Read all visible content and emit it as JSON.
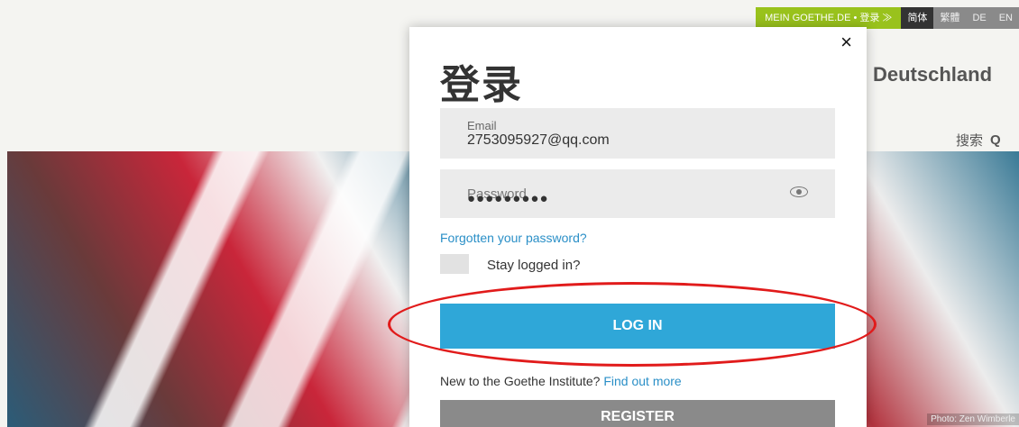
{
  "topbar": {
    "mein_goethe": "MEIN GOETHE.DE • 登录 ≫",
    "languages": [
      "简体",
      "繁體",
      "DE",
      "EN"
    ]
  },
  "header": {
    "site_name_partial": "Deutschland",
    "search_label": "搜索",
    "search_icon_glyph": "Q"
  },
  "modal": {
    "close_glyph": "×",
    "title": "登录",
    "email_label": "Email",
    "email_value": "2753095927@qq.com",
    "password_label": "Password",
    "password_dots": "●●●●●●●●●",
    "forgot_link": "Forgotten your password?",
    "stay_logged_in": "Stay logged in?",
    "login_button": "LOG IN",
    "new_text": "New to the Goethe Institute?",
    "find_out_more": "Find out more",
    "register_button": "REGISTER"
  },
  "hero": {
    "photo_credit": "Photo: Zen Wimberle"
  },
  "colors": {
    "accent_green": "#99c21c",
    "login_blue": "#2fa7d8",
    "annotation_red": "#e11b1b"
  }
}
